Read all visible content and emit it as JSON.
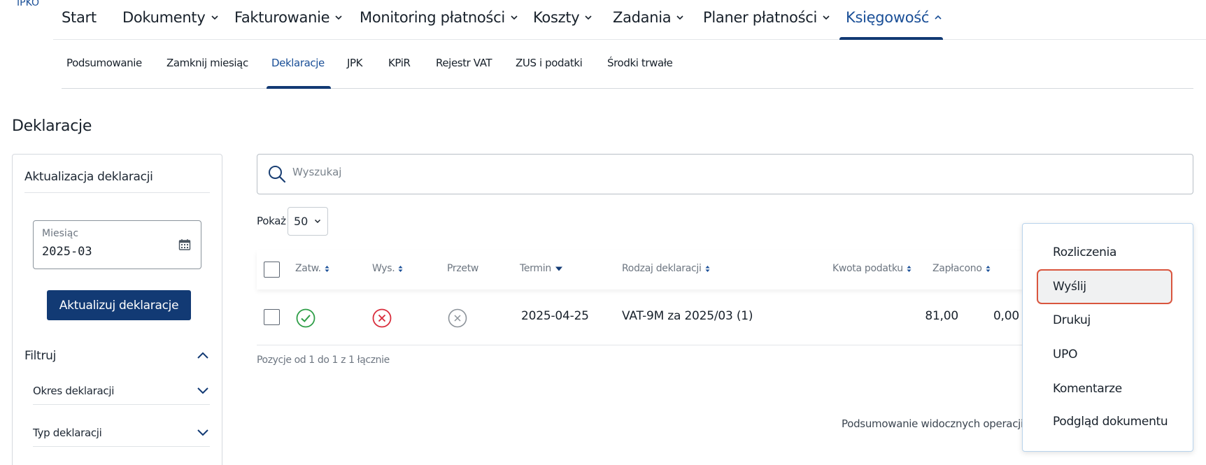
{
  "brand": {
    "text": "IPKO"
  },
  "topnav": {
    "items": [
      {
        "label": "Start"
      },
      {
        "label": "Dokumenty"
      },
      {
        "label": "Fakturowanie"
      },
      {
        "label": "Monitoring płatności"
      },
      {
        "label": "Koszty"
      },
      {
        "label": "Zadania"
      },
      {
        "label": "Planer płatności"
      },
      {
        "label": "Księgowość"
      }
    ],
    "active_index": 7
  },
  "subnav": {
    "items": [
      {
        "label": "Podsumowanie"
      },
      {
        "label": "Zamknij miesiąc"
      },
      {
        "label": "Deklaracje"
      },
      {
        "label": "JPK"
      },
      {
        "label": "KPiR"
      },
      {
        "label": "Rejestr VAT"
      },
      {
        "label": "ZUS i podatki"
      },
      {
        "label": "Środki trwałe"
      }
    ],
    "active_index": 2
  },
  "page": {
    "title": "Deklaracje"
  },
  "left_panel": {
    "title": "Aktualizacja deklaracji",
    "month_label": "Miesiąc",
    "month_value": "2025-03",
    "update_button": "Aktualizuj deklaracje",
    "filter_label": "Filtruj",
    "filters": [
      {
        "label": "Okres deklaracji"
      },
      {
        "label": "Typ deklaracji"
      }
    ]
  },
  "search": {
    "placeholder": "Wyszukaj"
  },
  "page_size": {
    "label": "Pokaż",
    "value": "50"
  },
  "table": {
    "columns": {
      "approved": "Zatw.",
      "sent": "Wys.",
      "processed": "Przetw",
      "deadline": "Termin",
      "type": "Rodzaj deklaracji",
      "tax_amount": "Kwota podatku",
      "paid": "Zapłacono"
    },
    "rows": [
      {
        "approved": "ok",
        "sent": "error",
        "processed": "pending",
        "deadline": "2025-04-25",
        "type": "VAT-9M za 2025/03 (1)",
        "tax_amount": "81,00",
        "paid": "0,00"
      }
    ],
    "pagination_text": "Pozycje od 1 do 1 z 1 łącznie",
    "summary_label": "Podsumowanie widocznych operacji"
  },
  "context_menu": {
    "items": [
      {
        "label": "Rozliczenia"
      },
      {
        "label": "Wyślij"
      },
      {
        "label": "Drukuj"
      },
      {
        "label": "UPO"
      },
      {
        "label": "Komentarze"
      },
      {
        "label": "Podgląd dokumentu"
      }
    ],
    "highlighted_index": 1
  },
  "colors": {
    "primary": "#123a74",
    "accent": "#1a4f97",
    "success": "#2e9e47",
    "error": "#d92d3c",
    "muted": "#8c939a",
    "highlight_border": "#d9553e"
  },
  "icons": {
    "search": "search-icon",
    "calendar": "calendar-icon",
    "chevron_down": "chevron-down-icon",
    "chevron_up": "chevron-up-icon",
    "sort": "sort-icon",
    "status_ok": "check-circle-icon",
    "status_error": "x-circle-icon",
    "status_pending": "x-circle-gray-icon"
  }
}
